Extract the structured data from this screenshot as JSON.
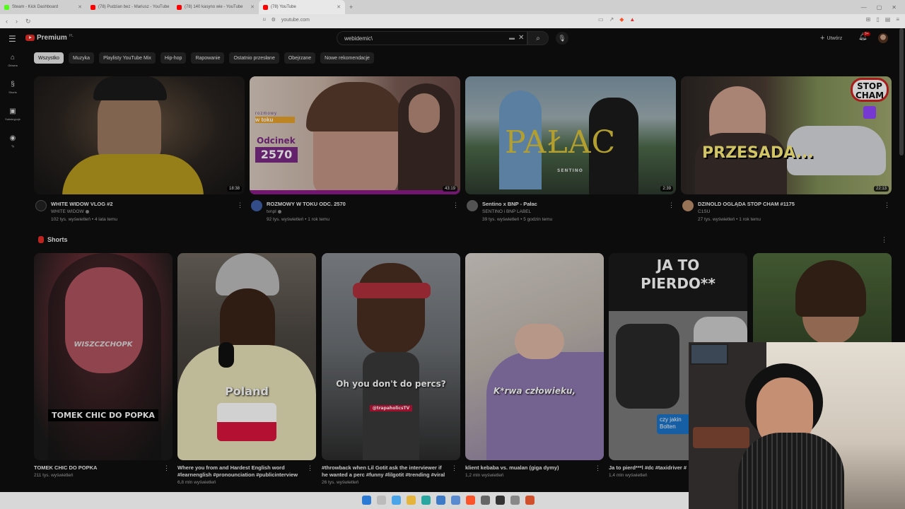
{
  "browser": {
    "tabs": [
      {
        "title": "Steam - Kick Dashboard",
        "color": "#53fc18"
      },
      {
        "title": "(78) Pudzian bez - Mariusz - YouTube",
        "color": "#ff0000"
      },
      {
        "title": "(78) 140 kasyno wie - YouTube",
        "color": "#ff0000"
      },
      {
        "title": "(78) YouTube",
        "color": "#ff0000"
      }
    ],
    "url": "youtube.com"
  },
  "youtube": {
    "logo_text": "Premium",
    "logo_region": "PL",
    "search_query": "webidemic\\",
    "create_label": "Utwórz",
    "notif_count": "9+",
    "guide": [
      {
        "label": "Główna",
        "icon": "home-icon",
        "glyph": "⌂"
      },
      {
        "label": "Shorts",
        "icon": "shorts-icon",
        "glyph": "§"
      },
      {
        "label": "Subskrypcje",
        "icon": "subscriptions-icon",
        "glyph": "▣"
      },
      {
        "label": "Ty",
        "icon": "you-icon",
        "glyph": "◉"
      }
    ],
    "chips": [
      "Wszystko",
      "Muzyka",
      "Playlisty YouTube Mix",
      "Hip-hop",
      "Rapowanie",
      "Ostatnio przesłane",
      "Obejrzane",
      "Nowe rekomendacje"
    ],
    "videos": [
      {
        "title": "WHITE WIDOW VLOG #2",
        "channel": "WHITE WIDOW",
        "stats": "102 tys. wyświetleń • 4 lata temu",
        "duration": "18:38"
      },
      {
        "title": "ROZMOWY W TOKU ODC. 2570",
        "channel": "tvnpl",
        "stats": "92 tys. wyświetleń • 1 rok temu",
        "duration": "43:19"
      },
      {
        "title": "Sentino x BNP - Pałac",
        "channel": "SENTINO i BNP LABEL",
        "stats": "39 tys. wyświetleń • 5 godzin temu",
        "duration": "2:39"
      },
      {
        "title": "DZINOLD OGLĄDA STOP CHAM #1175",
        "channel": "C1SU",
        "stats": "27 tys. wyświetleń • 1 rok temu",
        "duration": "22:13"
      }
    ],
    "thumb_text": {
      "rwt_brand_1": "rozmowy",
      "rwt_brand_2": "w toku",
      "rwt_ep_label": "Odcinek",
      "rwt_ep_num": "2570",
      "palac": "PAŁAC",
      "sentino": "SENTINO",
      "przesada": "PRZESADA...",
      "stop_cham": "STOP CHAM"
    },
    "shorts_title": "Shorts",
    "shorts": [
      {
        "title": "TOMEK CHIC DO POPKA",
        "views": "211 tys. wyświetleń",
        "caption": "TOMEK CHIC DO POPKA"
      },
      {
        "title": "Where you from and Hardest English word #learnenglish #pronounciation #publicinterview",
        "views": "6,8 mln wyświetleń",
        "caption": "Poland"
      },
      {
        "title": "#throwback when Lil Gotit ask the interviewer if he wanted a perc #funny #lilgotit #trending #viral",
        "views": "26 tys. wyświetleń",
        "caption": "Oh you don't do percs?"
      },
      {
        "title": "klient kebaba vs. mualan (giga dymy)",
        "views": "1,2 mln wyświetleń",
        "caption": "K*rwa człowieku,"
      },
      {
        "title": "Ja to pierd***l #dc #taxidriver #",
        "views": "1,4 mln wyświetleń",
        "caption": "JA TO PIERDO**"
      },
      {
        "title": "",
        "views": "",
        "caption": ""
      }
    ],
    "shorts_extra_text": {
      "wiszcz": "WISZCZCHOPK",
      "trap": "@trapaholicsTV",
      "czy": "czy jakin",
      "bolt": "Bolten"
    }
  }
}
